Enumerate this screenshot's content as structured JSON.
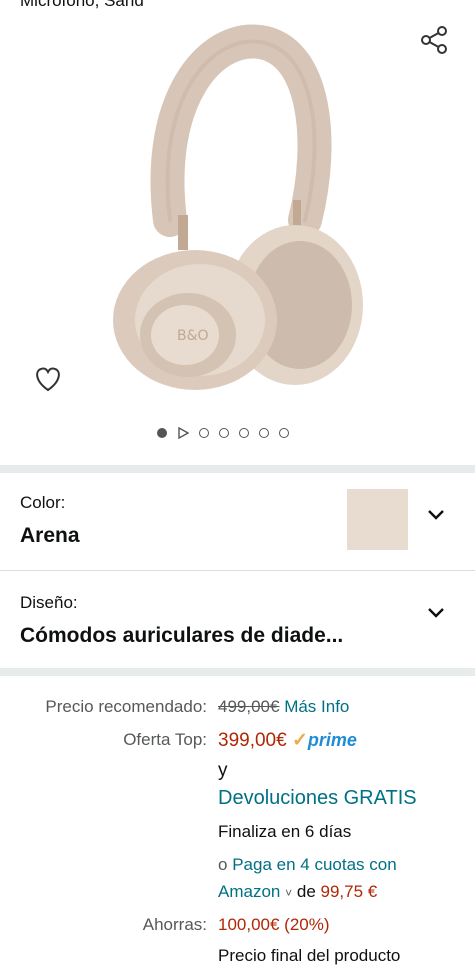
{
  "header": {
    "title_fragment": "Micrófono, Sand"
  },
  "carousel": {
    "image_alt": "headphones-product-image",
    "dot_count": 5,
    "active_index": 0
  },
  "variations": {
    "color_label": "Color:",
    "color_value": "Arena",
    "color_swatch": "#e8dcd0",
    "design_label": "Diseño:",
    "design_value": "Cómodos auriculares de diade..."
  },
  "pricing": {
    "list_label": "Precio recomendado:",
    "list_price": "499,00€",
    "more_info": "Más Info",
    "offer_label": "Oferta Top:",
    "offer_price": "399,00€",
    "prime_check": "✓",
    "prime_word": "prime",
    "and_text": "y",
    "returns": "Devoluciones GRATIS",
    "ends": "Finaliza en 6 días",
    "installments_prefix": "o",
    "installments_link_1": "Paga en 4 cuotas con",
    "installments_link_2": "Amazon",
    "installments_chevron": "˅",
    "installments_of": "de",
    "installments_amount": "99,75 €",
    "savings_label": "Ahorras:",
    "savings_value": "100,00€ (20%)",
    "final_price_text": "Precio final del producto"
  }
}
